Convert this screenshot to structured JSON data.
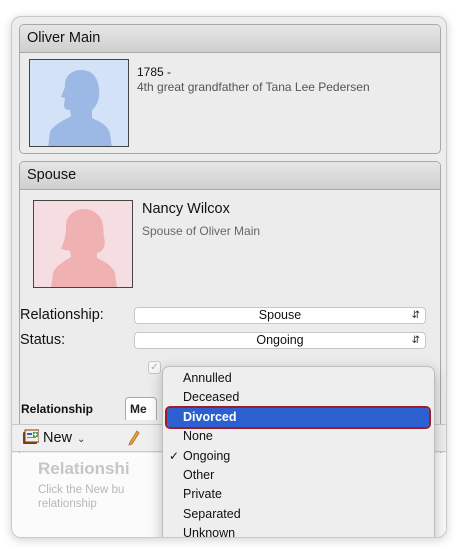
{
  "person": {
    "name": "Oliver Main",
    "year": "1785 -",
    "description": "4th great grandfather of Tana Lee Pedersen"
  },
  "spouse_section": {
    "title": "Spouse",
    "name": "Nancy Wilcox",
    "description": "Spouse of Oliver Main"
  },
  "fields": {
    "relationship_label": "Relationship:",
    "relationship_value": "Spouse",
    "status_label": "Status:",
    "status_value": "Ongoing"
  },
  "tabs": {
    "relationship_label": "Relationship",
    "second_tab": "Me"
  },
  "toolbar": {
    "new_label": "New"
  },
  "empty_state": {
    "title": "Relationshi",
    "line1": "Click the New bu",
    "line2": "relationship"
  },
  "status_menu": {
    "items": [
      "Annulled",
      "Deceased",
      "Divorced",
      "None",
      "Ongoing",
      "Other",
      "Private",
      "Separated",
      "Unknown"
    ],
    "highlighted": "Divorced",
    "checked": "Ongoing"
  },
  "colors": {
    "male_silhouette_bg": "#d4e2f7",
    "male_silhouette": "#9cb8e4",
    "female_silhouette_bg": "#f6dde1",
    "female_silhouette": "#f0b1b3",
    "menu_highlight": "#2c5fcf",
    "highlight_outline": "#9b1c2a"
  },
  "icons": {
    "new": "new-record-icon",
    "edit": "pencil-icon",
    "check": "checkmark-icon",
    "chevron": "chevron-updown-icon"
  }
}
